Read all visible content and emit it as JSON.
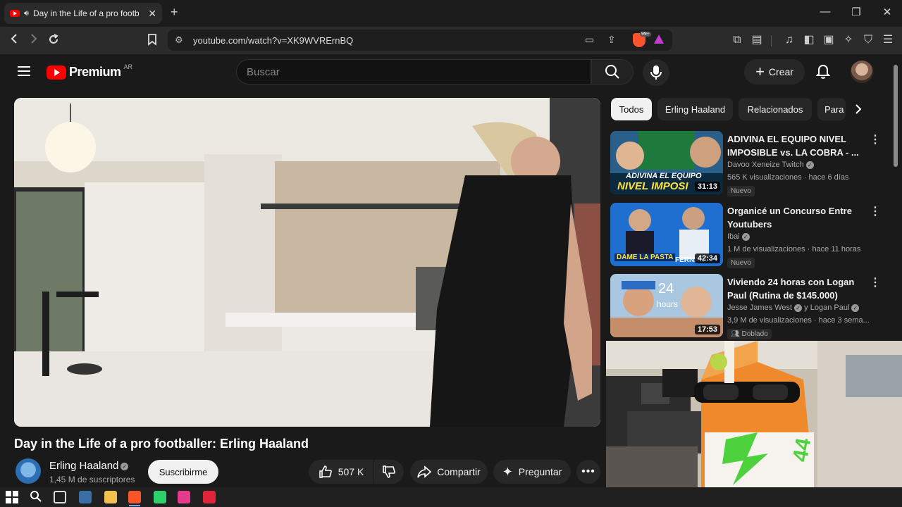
{
  "browser": {
    "tab_title": "Day in the Life of a pro footb",
    "url": "youtube.com/watch?v=XK9WVRErnBQ",
    "shield_count": "99+"
  },
  "header": {
    "logo_text": "Premium",
    "country": "AR",
    "search_placeholder": "Buscar",
    "create_label": "Crear"
  },
  "video": {
    "title": "Day in the Life of a pro footballer: Erling Haaland",
    "channel": "Erling Haaland",
    "subscribers": "1,45 M de suscriptores",
    "subscribe_label": "Suscribirme",
    "likes": "507 K",
    "share_label": "Compartir",
    "ask_label": "Preguntar"
  },
  "chips": [
    "Todos",
    "Erling Haaland",
    "Relacionados",
    "Para"
  ],
  "recommendations": [
    {
      "title_l1": "ADIVINA EL EQUIPO NIVEL",
      "title_l2": "IMPOSIBLE vs. LA COBRA - ...",
      "channel": "Davoo Xeneize Twitch",
      "meta": "565 K visualizaciones · hace 6 días",
      "badge": "Nuevo",
      "duration": "31:13",
      "thumb_text": "NIVEL IMPOSI",
      "thumb_text2": "ADIVINA EL EQUIPO"
    },
    {
      "title_l1": "Organicé un Concurso Entre",
      "title_l2": "Youtubers",
      "channel": "Ibai",
      "meta": "1 M de visualizaciones · hace 11 horas",
      "badge": "Nuevo",
      "duration": "42:34",
      "thumb_text": "DAME LA PASTA",
      "thumb_text2": "FERNAN"
    },
    {
      "title_l1": "Viviendo 24 horas con Logan",
      "title_l2": "Paul (Rutina de $145.000)",
      "channel": "Jesse James West",
      "channel2": "y Logan Paul",
      "meta": "3,9 M de visualizaciones · hace 3 sema...",
      "badge": "Doblado",
      "duration": "17:53",
      "thumb_text": "24",
      "thumb_text2": "hours"
    }
  ],
  "webcam": {
    "can_text": "44"
  },
  "colors": {
    "yt_red": "#ff0000",
    "background": "#0f0f0f",
    "surface": "#272727"
  }
}
